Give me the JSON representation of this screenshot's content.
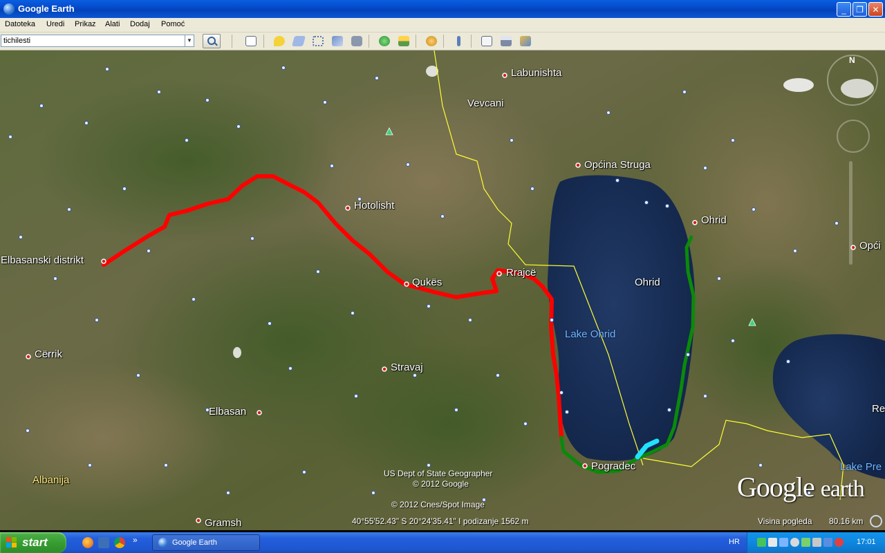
{
  "window": {
    "title": "Google Earth",
    "minimize_label": "_",
    "maximize_label": "❐",
    "close_label": "✕"
  },
  "menu": {
    "items": [
      "Datoteka",
      "Uredi",
      "Prikaz",
      "Alati",
      "Dodaj",
      "Pomoć"
    ]
  },
  "toolbar": {
    "search_value": "tichilesti",
    "dropdown_glyph": "▼",
    "icons": [
      "sidebar-toggle-icon",
      "add-placemark-icon",
      "add-polygon-icon",
      "add-path-icon",
      "add-image-overlay-icon",
      "record-tour-icon",
      "historical-imagery-icon",
      "sunlight-icon",
      "planets-icon",
      "ruler-icon",
      "email-icon",
      "print-icon",
      "save-image-icon"
    ]
  },
  "map": {
    "places": [
      {
        "name": "Labunishta",
        "style": "white"
      },
      {
        "name": "Vevcani",
        "style": "white"
      },
      {
        "name": "Općina Struga",
        "style": "white"
      },
      {
        "name": "Ohrid",
        "style": "white"
      },
      {
        "name": "Hotolisht",
        "style": "white"
      },
      {
        "name": "Elbasanski distrikt",
        "style": "white"
      },
      {
        "name": "Rrajcë",
        "style": "white"
      },
      {
        "name": "Qukës",
        "style": "white"
      },
      {
        "name": "Ohrid",
        "style": "white"
      },
      {
        "name": "Lake Ohrid",
        "style": "blue"
      },
      {
        "name": "Cërrik",
        "style": "white"
      },
      {
        "name": "Stravaj",
        "style": "white"
      },
      {
        "name": "Elbasan",
        "style": "white"
      },
      {
        "name": "Pogradec",
        "style": "white"
      },
      {
        "name": "Albanija",
        "style": "yellow"
      },
      {
        "name": "Gramsh",
        "style": "white"
      },
      {
        "name": "Opći",
        "style": "white"
      },
      {
        "name": "Re",
        "style": "white"
      },
      {
        "name": "Lake Pre",
        "style": "blue"
      }
    ],
    "credits": [
      "US Dept of State Geographer",
      "© 2012 Google",
      "© 2012 Cnes/Spot Image"
    ],
    "logo_google": "Google",
    "logo_earth": "earth",
    "compass_north": "N",
    "coordinates": "40°55'52.43\" S  20°24'35.41\" I  podizanje  1562 m",
    "eye_alt_label": "Visina pogleda",
    "eye_alt_value": "80.16 km",
    "route_colors": {
      "red": "#ff0000",
      "green": "#0a8a0a",
      "cyan": "#22e0ff",
      "border": "#ffff33"
    }
  },
  "taskbar": {
    "start_label": "start",
    "more_glyph": "»",
    "task_label": "Google Earth",
    "lang": "HR",
    "clock": "17:01"
  }
}
